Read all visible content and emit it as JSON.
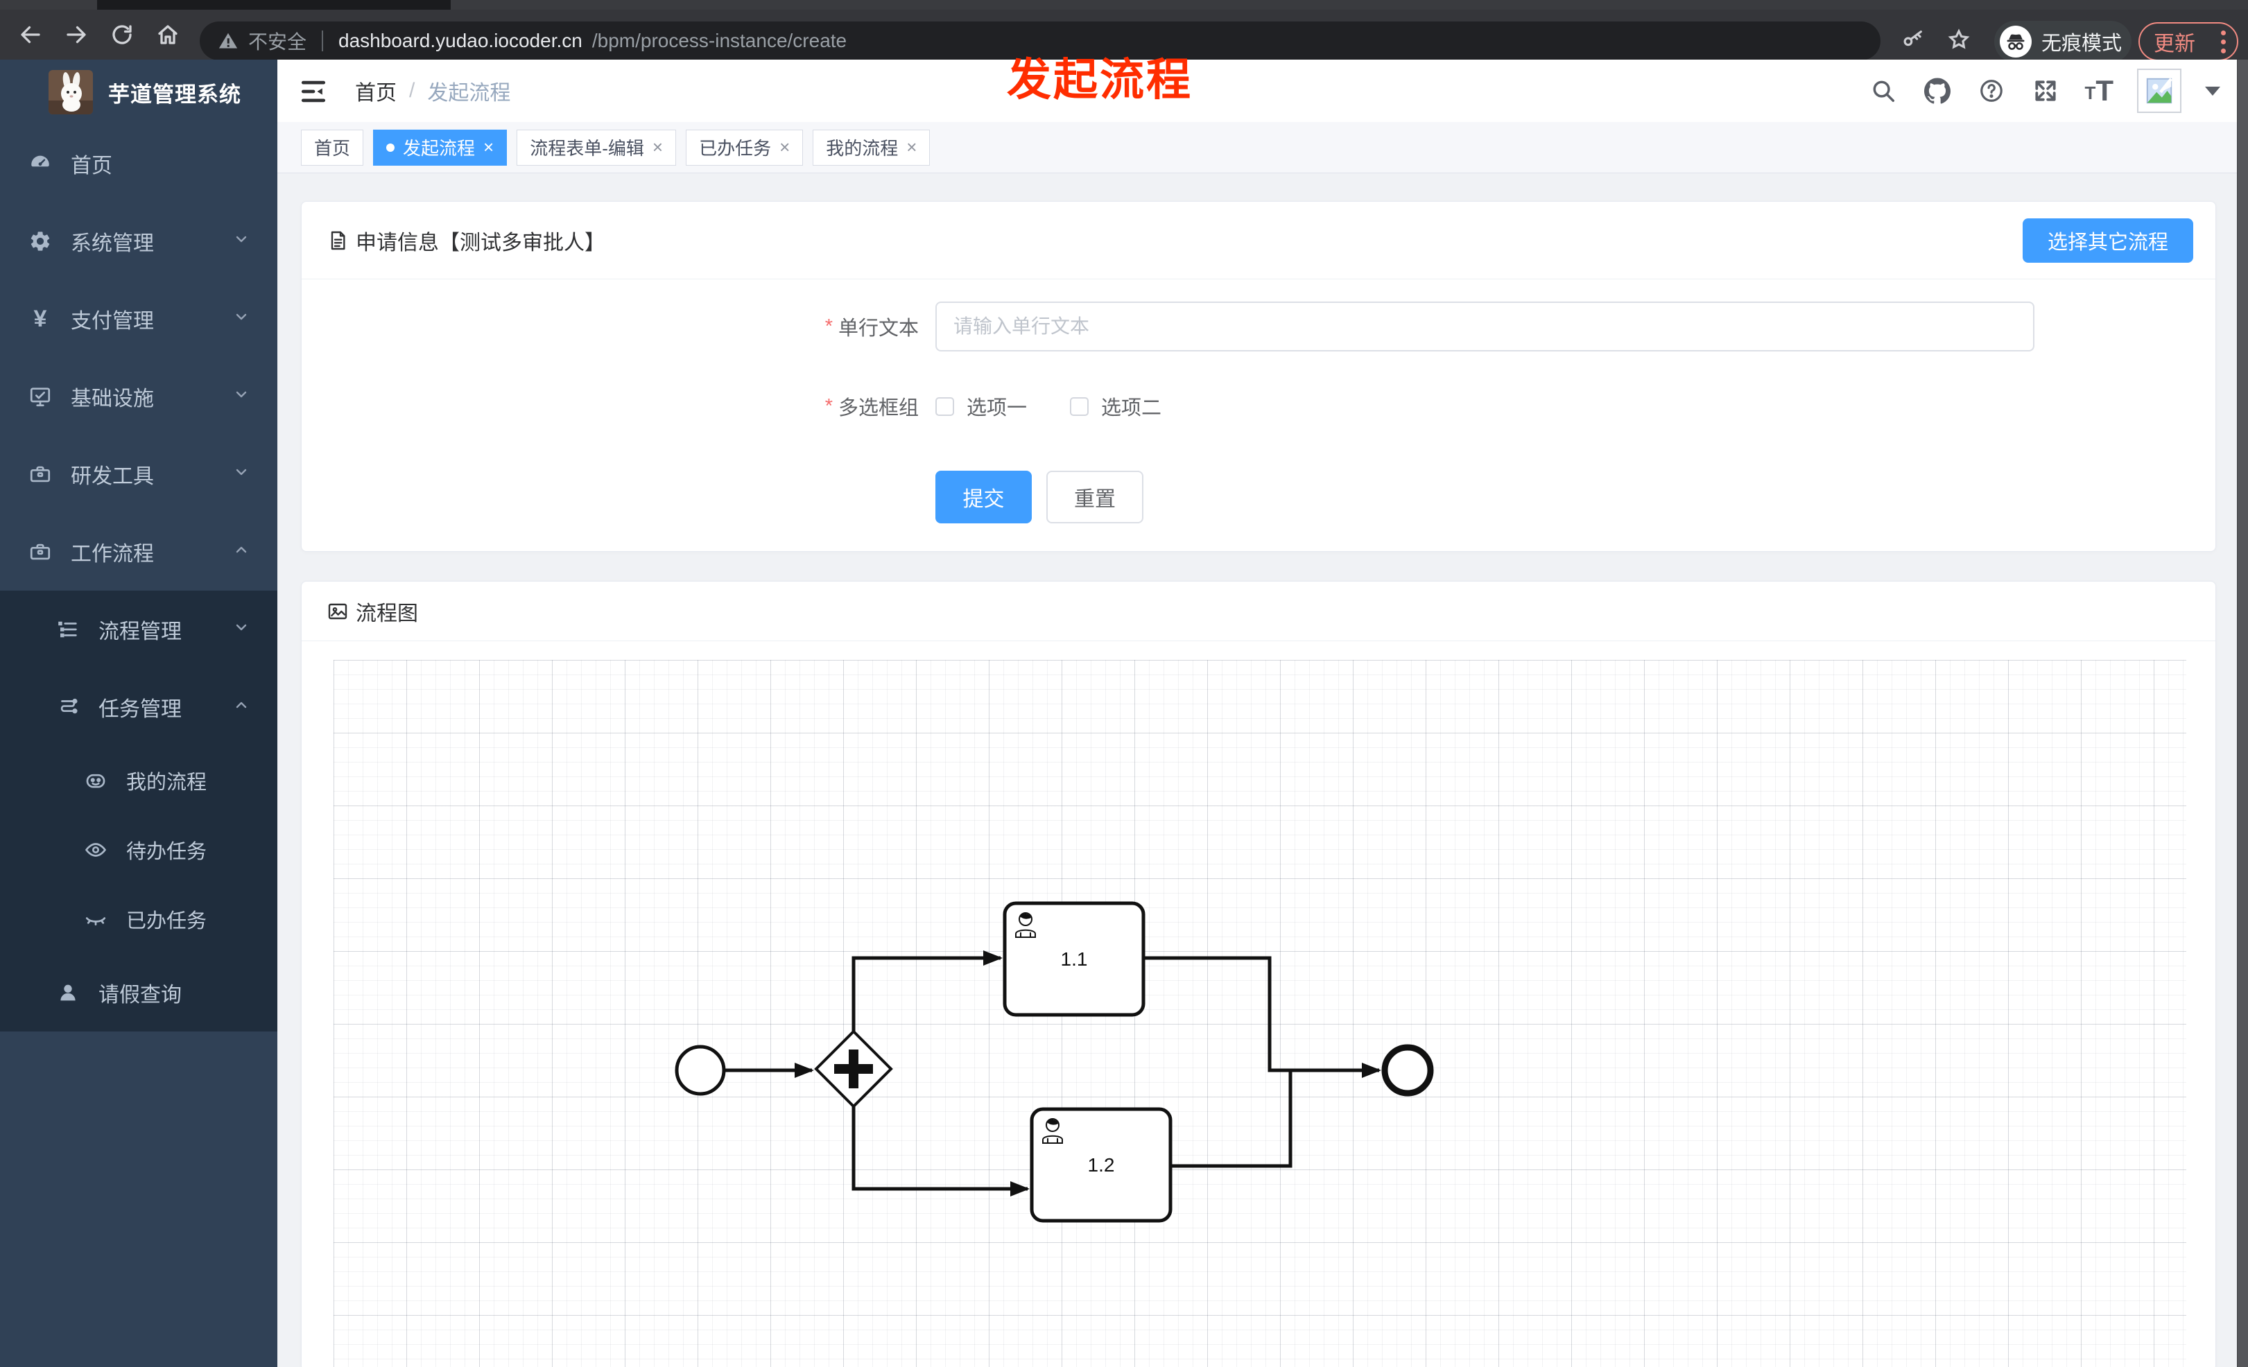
{
  "annotation": {
    "text": "发起流程",
    "color": "#ff2d00"
  },
  "browser": {
    "security_label": "不安全",
    "url_host": "dashboard.yudao.iocoder.cn",
    "url_path": "/bpm/process-instance/create",
    "incognito_label": "无痕模式",
    "update_label": "更新"
  },
  "sidebar": {
    "logo_title": "芋道管理系统",
    "yen_glyph": "¥",
    "items": [
      {
        "label": "首页",
        "icon": "dashboard-icon",
        "level": 1
      },
      {
        "label": "系统管理",
        "icon": "gear-icon",
        "level": 1,
        "chevron": "down"
      },
      {
        "label": "支付管理",
        "icon": "yen-icon",
        "level": 1,
        "chevron": "down"
      },
      {
        "label": "基础设施",
        "icon": "monitor-icon",
        "level": 1,
        "chevron": "down"
      },
      {
        "label": "研发工具",
        "icon": "toolbox-icon",
        "level": 1,
        "chevron": "down"
      },
      {
        "label": "工作流程",
        "icon": "toolbox-icon",
        "level": 1,
        "chevron": "up",
        "expanded": true
      },
      {
        "label": "流程管理",
        "icon": "list-icon",
        "level": 2,
        "chevron": "down"
      },
      {
        "label": "任务管理",
        "icon": "flow-icon",
        "level": 2,
        "chevron": "up",
        "expanded": true
      },
      {
        "label": "我的流程",
        "icon": "face-icon",
        "level": 3
      },
      {
        "label": "待办任务",
        "icon": "eye-icon",
        "level": 3
      },
      {
        "label": "已办任务",
        "icon": "eye-closed-icon",
        "level": 3
      },
      {
        "label": "请假查询",
        "icon": "user-icon",
        "level": 2
      }
    ]
  },
  "header": {
    "breadcrumb": [
      "首页",
      "发起流程"
    ],
    "breadcrumb_separator": "/",
    "help_glyph": "?",
    "font_icon_small": "T",
    "font_icon_large": "T"
  },
  "tags": {
    "close_glyph": "×",
    "items": [
      {
        "label": "首页",
        "active": false,
        "closable": false
      },
      {
        "label": "发起流程",
        "active": true,
        "closable": true
      },
      {
        "label": "流程表单-编辑",
        "active": false,
        "closable": true
      },
      {
        "label": "已办任务",
        "active": false,
        "closable": true
      },
      {
        "label": "我的流程",
        "active": false,
        "closable": true
      }
    ]
  },
  "form_card": {
    "title": "申请信息【测试多审批人】",
    "choose_button": "选择其它流程",
    "required_mark": "*",
    "fields": [
      {
        "label": "单行文本",
        "required": true,
        "type": "input",
        "placeholder": "请输入单行文本",
        "value": ""
      },
      {
        "label": "多选框组",
        "required": true,
        "type": "checkbox-group",
        "options": [
          "选项一",
          "选项二"
        ],
        "checked": []
      }
    ],
    "submit_label": "提交",
    "reset_label": "重置"
  },
  "diagram_card": {
    "title": "流程图",
    "nodes": [
      {
        "id": "start",
        "type": "startEvent"
      },
      {
        "id": "gateway",
        "type": "parallelGateway"
      },
      {
        "id": "task1",
        "type": "userTask",
        "label": "1.1"
      },
      {
        "id": "task2",
        "type": "userTask",
        "label": "1.2"
      },
      {
        "id": "end",
        "type": "endEvent"
      }
    ],
    "edges": [
      {
        "from": "start",
        "to": "gateway"
      },
      {
        "from": "gateway",
        "to": "task1"
      },
      {
        "from": "gateway",
        "to": "task2"
      },
      {
        "from": "task1",
        "to": "end"
      },
      {
        "from": "task2",
        "to": "end"
      }
    ]
  },
  "colors": {
    "accent": "#409EFF",
    "sidebar_bg": "#304156",
    "submenu_bg": "#1f2d3d",
    "danger": "#f56c6c",
    "annotation_red": "#ff2d00",
    "chrome_toolbar": "#35363a",
    "update_salmon": "#f28b82"
  }
}
